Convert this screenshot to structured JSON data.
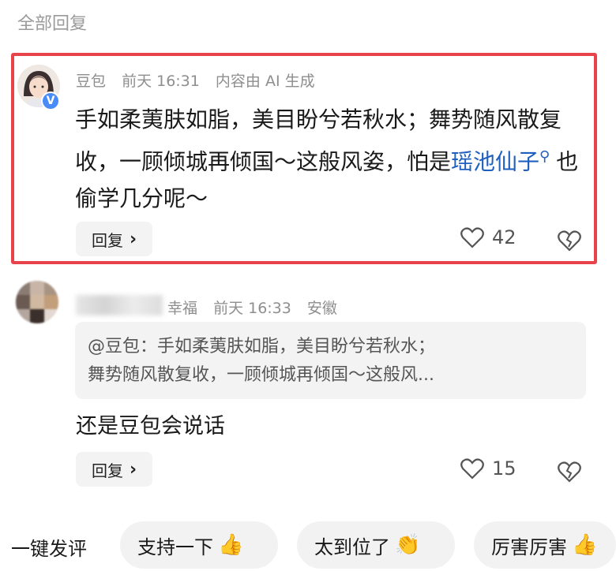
{
  "section_title": "全部回复",
  "comments": [
    {
      "author": "豆包",
      "time": "前天 16:31",
      "ai_label": "内容由 AI 生成",
      "verified_badge": "V",
      "text_before": "手如柔荑肤如脂，美目盼兮若秋水；舞势随风散复收，一顾倾城再倾国～这般风姿，怕是",
      "keyword": "瑶池仙子",
      "text_after": "也偷学几分呢～",
      "reply_label": "回复",
      "likes": "42"
    },
    {
      "author": "幸福",
      "time": "前天 16:33",
      "location": "安徽",
      "quote_line1": "@豆包：手如柔荑肤如脂，美目盼兮若秋水；",
      "quote_line2": "舞势随风散复收，一顾倾城再倾国～这般风...",
      "text": "还是豆包会说话",
      "reply_label": "回复",
      "likes": "15"
    }
  ],
  "quick_comment": {
    "label": "一键发评",
    "chips": [
      {
        "text": "支持一下",
        "emoji": "👍"
      },
      {
        "text": "太到位了",
        "emoji": "👏"
      },
      {
        "text": "厉害厉害",
        "emoji": "👍"
      }
    ]
  },
  "colors": {
    "highlight_border": "#e8434a",
    "link": "#1f5fbf",
    "verified": "#4a8cf7"
  }
}
